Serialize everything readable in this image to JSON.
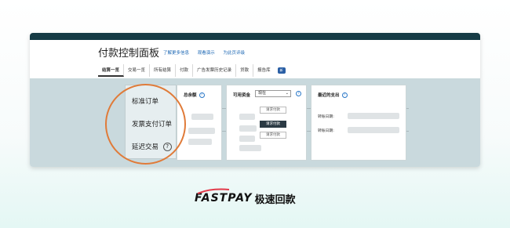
{
  "header": {
    "title": "付款控制面板",
    "links": [
      "了解更多信息",
      "观看演示",
      "为此页评级"
    ]
  },
  "tabs": [
    {
      "label": "结算一览"
    },
    {
      "label": "交易一览"
    },
    {
      "label": "所有结算"
    },
    {
      "label": "付款"
    },
    {
      "label": "广告发票历史记录"
    },
    {
      "label": "贷款"
    },
    {
      "label": "报告库"
    }
  ],
  "tab_badge": "新",
  "left_rows": [
    "标准订单",
    "发票支付订单",
    "延迟交易"
  ],
  "help_symbol": "?",
  "cards": {
    "total": {
      "title": "总余额",
      "help": "?"
    },
    "available": {
      "title": "可用资金",
      "help": "?",
      "select_value": "现在",
      "chevron": "⌄",
      "buttons": [
        "请求付款",
        "请求付款",
        "请求付款"
      ]
    },
    "recent": {
      "title": "最近的支出",
      "help": "?",
      "labels": [
        "转账日期:",
        "转账日期:"
      ]
    }
  },
  "logo": {
    "brand": "FASTPAY",
    "cn": "极速回款"
  },
  "colors": {
    "topbar": "#163b45",
    "accent": "#e07b39",
    "primary_button": "#2b3a44",
    "link": "#1a66b3"
  }
}
